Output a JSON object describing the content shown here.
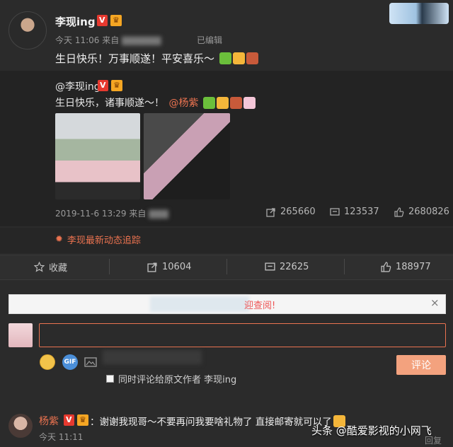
{
  "post": {
    "author": "李现ing",
    "badge_v": "V",
    "time": "今天 11:06 来自",
    "edited": "已编辑",
    "text": "生日快乐！万事顺遂！平安喜乐～"
  },
  "repost": {
    "author": "@李现ing",
    "text_prefix": "生日快乐，诸事顺遂～！",
    "mention": "@杨紫",
    "meta": "2019-11-6 13:29 来自",
    "reposts": "265660",
    "comments": "123537",
    "likes": "2680826"
  },
  "track_link": "李现最新动态追踪",
  "actions": {
    "favorite": "收藏",
    "forward": "10604",
    "comment": "22625",
    "like": "188977"
  },
  "banner": {
    "text": "迎查阅!",
    "close": "×"
  },
  "composer": {
    "placeholder": "",
    "gif": "GIF",
    "submit": "评论",
    "also_comment": "同时评论给原文作者 李现ing"
  },
  "comment": {
    "author": "杨紫",
    "text": "：谢谢我现哥～不要再问我要啥礼物了 直接邮寄就可以了",
    "time": "今天 11:11"
  },
  "watermark": {
    "text": "头条 @酷爱影视的小网飞",
    "tail": "回复"
  },
  "colors": {
    "accent": "#eb7350",
    "background": "#2b2b2b",
    "button": "#f3a27e"
  }
}
